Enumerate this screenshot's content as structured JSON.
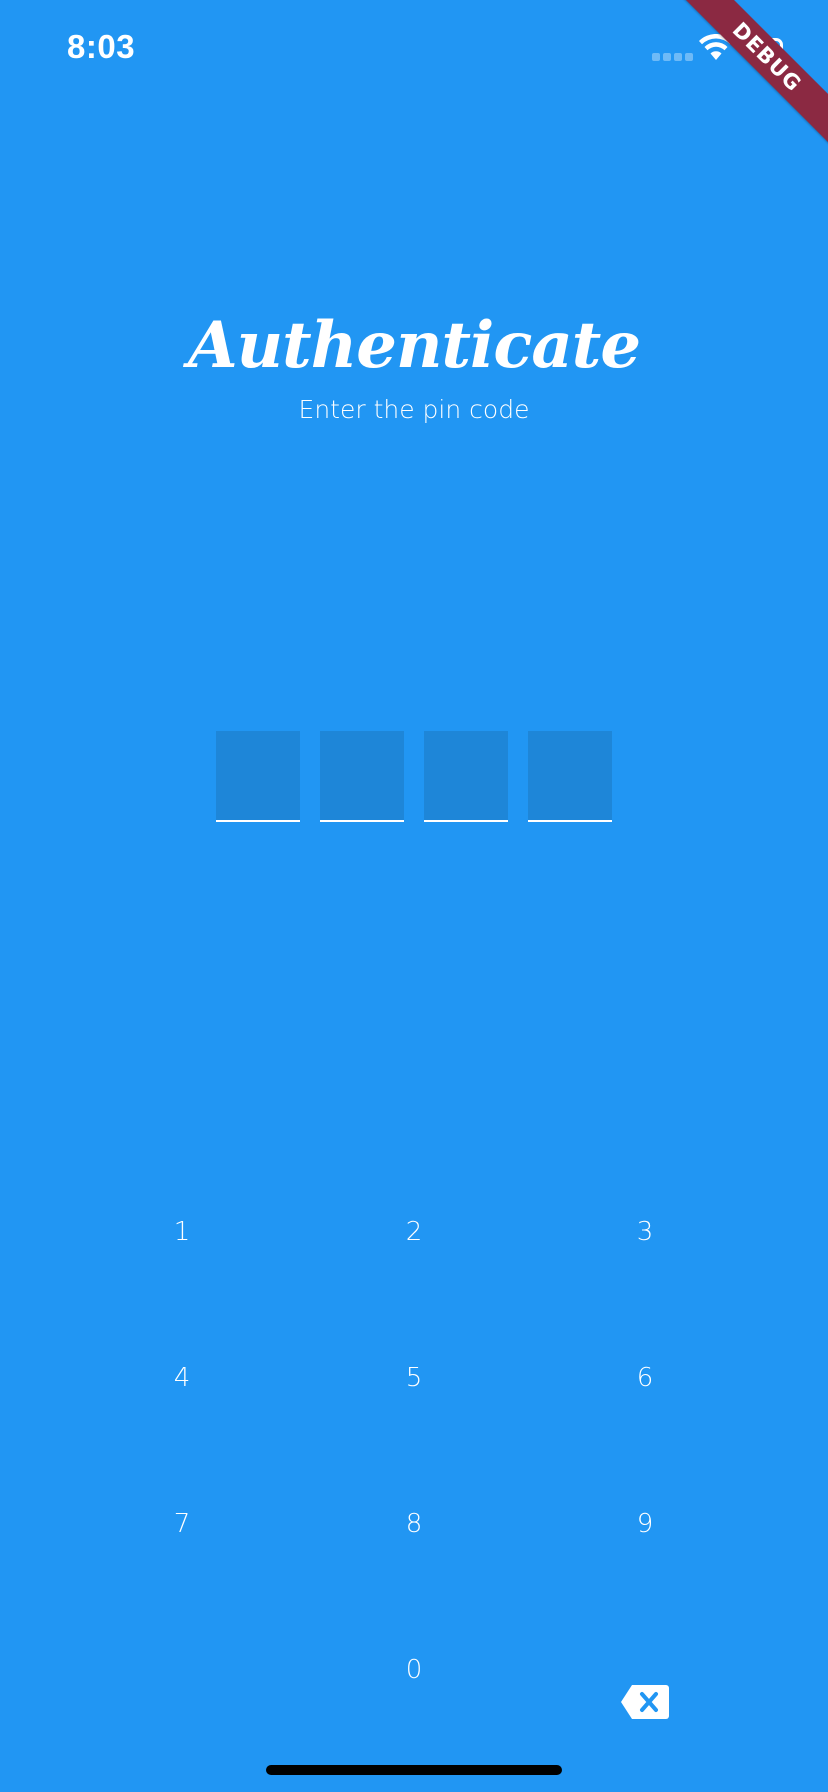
{
  "status_bar": {
    "time": "8:03",
    "wifi_icon": "wifi-icon",
    "battery_icon": "battery-icon",
    "signal_icon": "cellular-signal-icon"
  },
  "debug_banner": {
    "label": "DEBUG",
    "color": "#8B2942"
  },
  "header": {
    "title": "Authenticate",
    "subtitle": "Enter the pin code"
  },
  "pin": {
    "length": 4,
    "entered": 0
  },
  "keypad": {
    "keys": [
      "1",
      "2",
      "3",
      "4",
      "5",
      "6",
      "7",
      "8",
      "9",
      "0"
    ],
    "backspace_icon": "backspace-icon"
  },
  "colors": {
    "background": "#2196F3",
    "pin_box": "#1E86D8",
    "text": "#FFFFFF"
  }
}
